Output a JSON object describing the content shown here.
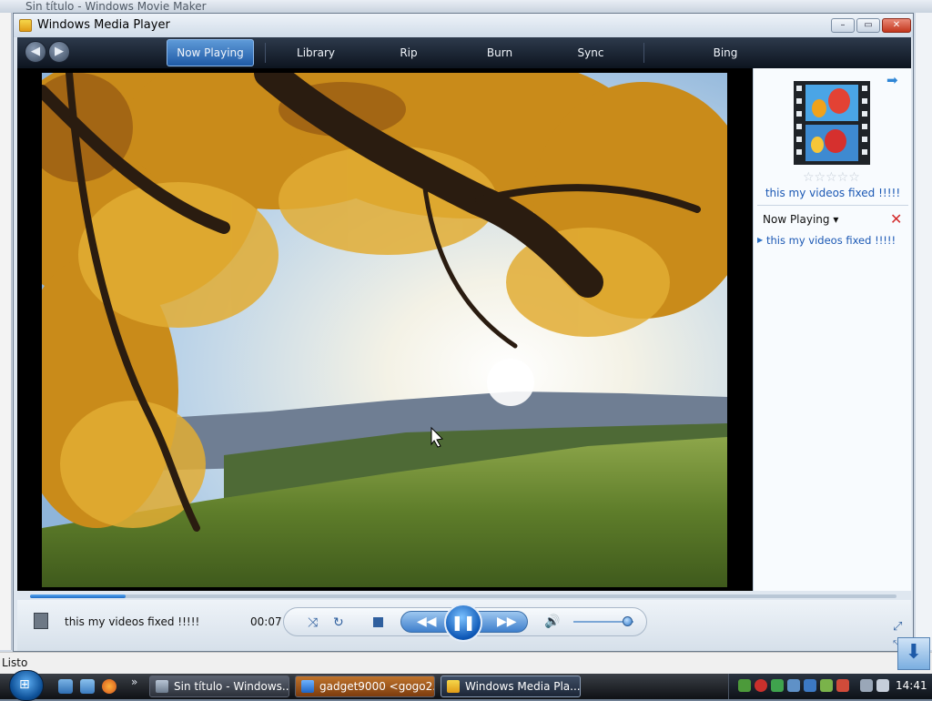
{
  "background_app": {
    "title": "Sin título - Windows Movie Maker",
    "status": "Listo"
  },
  "window": {
    "title": "Windows Media Player",
    "caption_buttons": {
      "minimize": "–",
      "maximize": "▭",
      "close": "✕"
    }
  },
  "nav": {
    "back_glyph": "◀",
    "forward_glyph": "▶",
    "tabs": [
      {
        "label": "Now Playing",
        "active": true
      },
      {
        "label": "Library",
        "active": false
      },
      {
        "label": "Rip",
        "active": false
      },
      {
        "label": "Burn",
        "active": false
      },
      {
        "label": "Sync",
        "active": false
      },
      {
        "label": "Bing",
        "active": false
      }
    ]
  },
  "pane": {
    "media_title": "this my videos fixed !!!!!",
    "rating_stars": "☆☆☆☆☆",
    "now_playing_label": "Now Playing ▾",
    "clear_glyph": "✕",
    "playlist": [
      "this my videos fixed !!!!!"
    ],
    "arrow_glyph": "➡"
  },
  "controls": {
    "media_title": "this my videos fixed !!!!!",
    "elapsed": "00:07",
    "progress_fraction": 0.11,
    "volume_fraction": 0.9,
    "shuffle_glyph": "⤨",
    "repeat_glyph": "↻",
    "prev_glyph": "◀◀",
    "next_glyph": "▶▶",
    "play_glyph": "❚❚",
    "volume_glyph": "🔊",
    "fullscreen_glyph": "⤢",
    "switch_glyph": "⤡"
  },
  "taskbar": {
    "start_glyph": "⊞",
    "more_glyph": "»",
    "tasks": [
      {
        "label": "Sin título - Windows..."
      },
      {
        "label": "gadget9000 <gogo2..."
      },
      {
        "label": "Windows Media Pla..."
      }
    ],
    "clock": "14:41"
  },
  "colors": {
    "accent": "#1f5aa6",
    "link": "#1b58b4",
    "nav_bg": "#0d141f"
  },
  "icons": {
    "wmp_icon": "wmp-logo-icon",
    "download": "download-arrow-icon"
  }
}
